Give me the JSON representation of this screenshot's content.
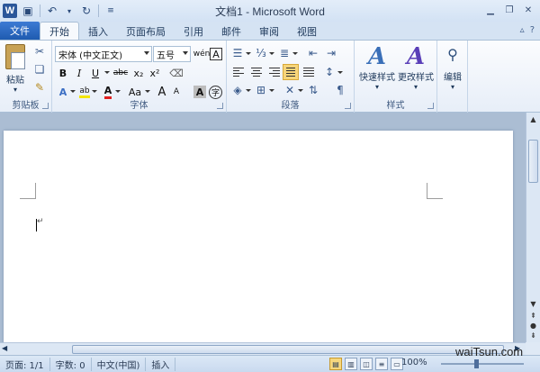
{
  "app": {
    "logo": "W",
    "title": "文档1 - Microsoft Word"
  },
  "tabs": {
    "file": "文件",
    "items": [
      "开始",
      "插入",
      "页面布局",
      "引用",
      "邮件",
      "审阅",
      "视图"
    ]
  },
  "ribbon": {
    "clipboard": {
      "label": "剪贴板",
      "paste": "粘贴"
    },
    "font": {
      "label": "字体",
      "font_name": "宋体 (中文正文)",
      "font_size": "五号",
      "bold": "B",
      "italic": "I",
      "underline": "U",
      "strike": "abc",
      "subscript": "x₂",
      "superscript": "x²",
      "grow": "A",
      "shrink": "A",
      "case": "Aa",
      "phonetic": "wén",
      "border_char": "A",
      "enclose": "字",
      "font_color": "A",
      "highlight": "ab"
    },
    "paragraph": {
      "label": "段落"
    },
    "styles": {
      "label": "样式",
      "quick": "快速样式",
      "change": "更改样式"
    },
    "editing": {
      "label": "编辑"
    }
  },
  "statusbar": {
    "page": "页面: 1/1",
    "words": "字数: 0",
    "language": "中文(中国)",
    "mode": "插入",
    "zoom": "100%"
  },
  "watermark": "waiTsun.com",
  "colors": {
    "accent": "#2b579a",
    "font_color": "#e02020",
    "highlight": "#f4e600"
  }
}
